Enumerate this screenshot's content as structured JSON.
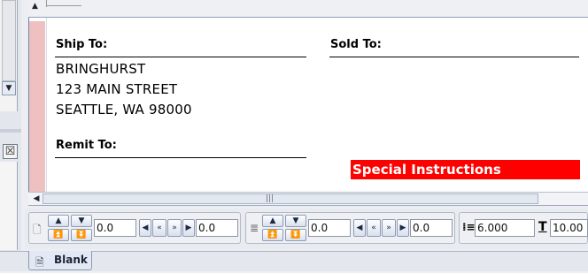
{
  "document": {
    "ship_to_label": "Ship To:",
    "sold_to_label": "Sold To:",
    "remit_to_label": "Remit To:",
    "ship_to_address": [
      "BRINGHURST",
      "123 MAIN STREET",
      "SEATTLE, WA 98000"
    ],
    "special_instructions": "Special Instructions"
  },
  "toolbar": {
    "group1": {
      "field_a": "0.0",
      "field_b": "0.0"
    },
    "group2": {
      "field_a": "0.0",
      "field_b": "0.0"
    },
    "group3": {
      "line_spacing": "6.000",
      "text_size": "10.00"
    }
  },
  "tabs": [
    {
      "label": "Blank"
    }
  ],
  "colors": {
    "special_bg": "#ff0000",
    "margin_strip": "#efc0c0"
  }
}
